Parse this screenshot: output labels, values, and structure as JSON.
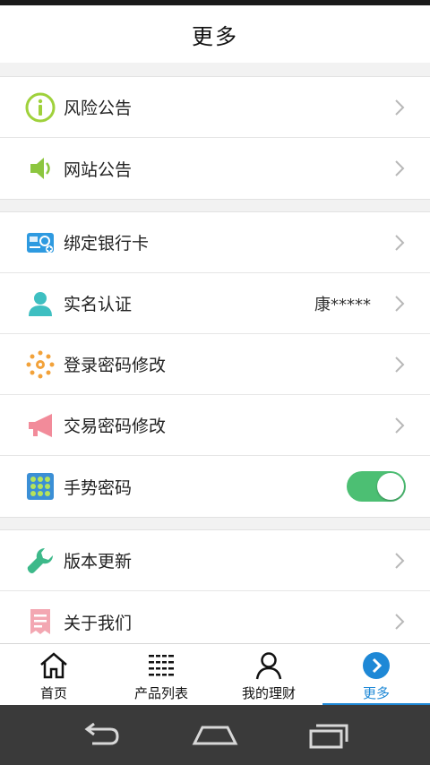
{
  "header": {
    "title": "更多"
  },
  "groups": [
    {
      "items": [
        {
          "label": "风险公告",
          "icon": "info-icon"
        },
        {
          "label": "网站公告",
          "icon": "speaker-icon"
        }
      ]
    },
    {
      "items": [
        {
          "label": "绑定银行卡",
          "icon": "bank-card-icon"
        },
        {
          "label": "实名认证",
          "icon": "person-icon",
          "value": "康*****"
        },
        {
          "label": "登录密码修改",
          "icon": "sun-gear-icon"
        },
        {
          "label": "交易密码修改",
          "icon": "megaphone-icon"
        },
        {
          "label": "手势密码",
          "icon": "gesture-grid-icon",
          "toggle_on": true
        }
      ]
    },
    {
      "items": [
        {
          "label": "版本更新",
          "icon": "wrench-icon"
        },
        {
          "label": "关于我们",
          "icon": "document-icon"
        }
      ]
    }
  ],
  "tabbar": {
    "tabs": [
      {
        "label": "首页",
        "icon": "home-icon"
      },
      {
        "label": "产品列表",
        "icon": "list-icon"
      },
      {
        "label": "我的理财",
        "icon": "user-icon"
      },
      {
        "label": "更多",
        "icon": "more-icon",
        "active": true
      }
    ]
  },
  "colors": {
    "accent": "#1e88d6",
    "toggle_on": "#4cbf73"
  },
  "system_nav": {
    "buttons": [
      "back-icon",
      "home-icon",
      "recents-icon"
    ]
  }
}
